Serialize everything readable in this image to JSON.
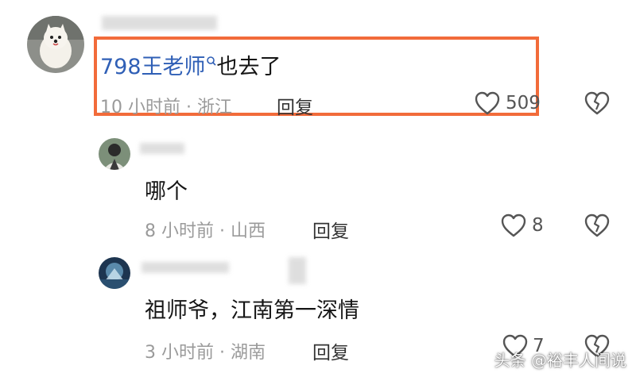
{
  "comments": [
    {
      "mention": "798王老师",
      "mention_icon": "search-icon",
      "text": "也去了",
      "time": "10 小时前",
      "location": "浙江",
      "reply": "回复",
      "likes": "509",
      "highlighted": true
    },
    {
      "text": "哪个",
      "time": "8 小时前",
      "location": "山西",
      "reply": "回复",
      "likes": "8"
    },
    {
      "text": "祖师爷，江南第一深情",
      "time": "3 小时前",
      "location": "湖南",
      "reply": "回复",
      "likes": "7"
    }
  ],
  "separator": "·",
  "icons": {
    "like": "heart-outline-icon",
    "dislike": "broken-heart-icon"
  },
  "colors": {
    "highlight_border": "#f26b3a",
    "mention": "#2f5fb6",
    "meta": "#9a9a9a"
  },
  "watermark": "头条 @裕丰人间说"
}
